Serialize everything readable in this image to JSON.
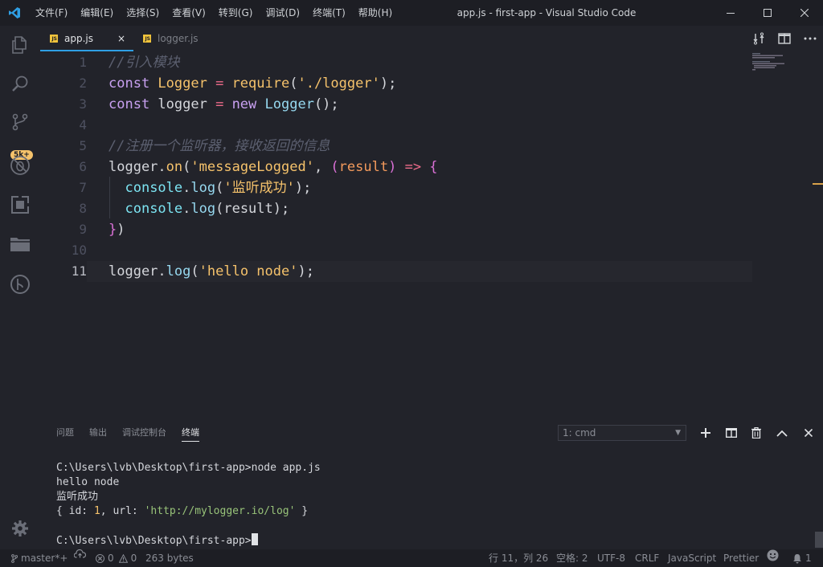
{
  "window": {
    "title": "app.js - first-app - Visual Studio Code",
    "menu": [
      "文件(F)",
      "编辑(E)",
      "选择(S)",
      "查看(V)",
      "转到(G)",
      "调试(D)",
      "终端(T)",
      "帮助(H)"
    ]
  },
  "activity": {
    "scm_badge": "5k+"
  },
  "tabs": [
    {
      "label": "app.js",
      "icon": "js",
      "active": true,
      "close": "×"
    },
    {
      "label": "logger.js",
      "icon": "js",
      "active": false
    }
  ],
  "editor": {
    "current_line": 11,
    "lines": [
      {
        "num": "1",
        "tokens": [
          [
            "c-com",
            "//引入模块"
          ]
        ]
      },
      {
        "num": "2",
        "tokens": [
          [
            "c-kw",
            "const "
          ],
          [
            "c-cls",
            "Logger"
          ],
          [
            "c-op",
            " = "
          ],
          [
            "c-fn",
            "require"
          ],
          [
            "c-punc",
            "("
          ],
          [
            "c-str",
            "'./logger'"
          ],
          [
            "c-punc",
            ");"
          ]
        ]
      },
      {
        "num": "3",
        "tokens": [
          [
            "c-kw",
            "const "
          ],
          [
            "c-var",
            "logger"
          ],
          [
            "c-op",
            " = "
          ],
          [
            "c-kw",
            "new "
          ],
          [
            "c-meth",
            "Logger"
          ],
          [
            "c-punc",
            "();"
          ]
        ]
      },
      {
        "num": "4",
        "tokens": []
      },
      {
        "num": "5",
        "tokens": [
          [
            "c-com",
            "//注册一个监听器，接收返回的信息"
          ]
        ]
      },
      {
        "num": "6",
        "tokens": [
          [
            "c-var",
            "logger"
          ],
          [
            "c-punc",
            "."
          ],
          [
            "c-fn",
            "on"
          ],
          [
            "c-punc",
            "("
          ],
          [
            "c-str",
            "'messageLogged'"
          ],
          [
            "c-punc",
            ", "
          ],
          [
            "c-brk2",
            "("
          ],
          [
            "c-param",
            "result"
          ],
          [
            "c-brk2",
            ")"
          ],
          [
            "c-op",
            " => "
          ],
          [
            "c-brk2",
            "{"
          ]
        ]
      },
      {
        "num": "7",
        "tokens": [
          [
            "c-punc",
            "  "
          ],
          [
            "c-con",
            "console"
          ],
          [
            "c-punc",
            "."
          ],
          [
            "c-meth",
            "log"
          ],
          [
            "c-punc",
            "("
          ],
          [
            "c-str",
            "'监听成功'"
          ],
          [
            "c-punc",
            ");"
          ]
        ]
      },
      {
        "num": "8",
        "tokens": [
          [
            "c-punc",
            "  "
          ],
          [
            "c-con",
            "console"
          ],
          [
            "c-punc",
            "."
          ],
          [
            "c-meth",
            "log"
          ],
          [
            "c-punc",
            "(result);"
          ]
        ]
      },
      {
        "num": "9",
        "tokens": [
          [
            "c-brk2",
            "}"
          ],
          [
            "c-punc",
            ")"
          ]
        ]
      },
      {
        "num": "10",
        "tokens": []
      },
      {
        "num": "11",
        "tokens": [
          [
            "c-var",
            "logger"
          ],
          [
            "c-punc",
            "."
          ],
          [
            "c-meth",
            "log"
          ],
          [
            "c-punc",
            "("
          ],
          [
            "c-str",
            "'hello node'"
          ],
          [
            "c-punc",
            ");"
          ]
        ]
      }
    ]
  },
  "panel": {
    "tabs": [
      "问题",
      "输出",
      "调试控制台",
      "终端"
    ],
    "active_tab": "终端",
    "terminal_select": "1: cmd",
    "terminal": {
      "prompt1": "C:\\Users\\lvb\\Desktop\\first-app>node app.js",
      "out1": "hello node",
      "out2": "监听成功",
      "obj_open": "{ id: ",
      "obj_id": "1",
      "obj_mid": ", url: ",
      "obj_url": "'http://mylogger.io/log'",
      "obj_close": " }",
      "prompt2": "C:\\Users\\lvb\\Desktop\\first-app>"
    }
  },
  "status": {
    "branch": "master*+",
    "errors": "0",
    "warnings": "0",
    "bytes": "263 bytes",
    "position": "行 11，列 26",
    "spaces": "空格: 2",
    "encoding": "UTF-8",
    "eol": "CRLF",
    "language": "JavaScript",
    "formatter": "Prettier",
    "notifications": "1"
  },
  "colors": {
    "background": "#22232a",
    "accent": "#2f9fe4",
    "badge": "#f5c26b"
  }
}
